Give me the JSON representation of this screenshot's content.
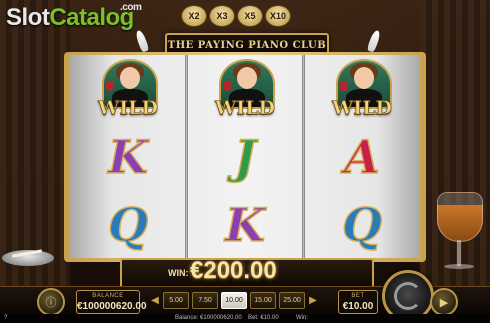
{
  "watermark": {
    "slot": "Slot",
    "catalog": "Catalog",
    "com": ".com"
  },
  "multipliers": [
    "X2",
    "X3",
    "X5",
    "X10"
  ],
  "title": "THE PAYING PIANO CLUB",
  "reels": [
    [
      {
        "type": "wild",
        "label": "WILD"
      },
      {
        "type": "letter",
        "label": "K",
        "color": "purple"
      },
      {
        "type": "letter",
        "label": "Q",
        "color": "blue"
      }
    ],
    [
      {
        "type": "wild",
        "label": "WILD"
      },
      {
        "type": "letter",
        "label": "J",
        "color": "green"
      },
      {
        "type": "letter",
        "label": "K",
        "color": "purple"
      }
    ],
    [
      {
        "type": "wild",
        "label": "WILD"
      },
      {
        "type": "letter",
        "label": "A",
        "color": "red"
      },
      {
        "type": "letter",
        "label": "Q",
        "color": "blue"
      }
    ]
  ],
  "win": {
    "label": "WIN:",
    "amount": "€200.00"
  },
  "balance": {
    "label": "BALANCE",
    "value": "€100000620.00"
  },
  "bet": {
    "label": "BET",
    "value": "€10.00"
  },
  "bet_options": [
    "5.00",
    "7.50",
    "10.00",
    "15.00",
    "25.00"
  ],
  "selected_bet": "10.00",
  "status_bar": {
    "left": "?",
    "balance": "Balance: €100000620.00",
    "bet": "Bet: €10.00",
    "win": "Win:"
  },
  "colors": {
    "gold": "#c9a24a",
    "win_text": "#f8e6a8",
    "reel_bg": "#e6e6e6"
  }
}
